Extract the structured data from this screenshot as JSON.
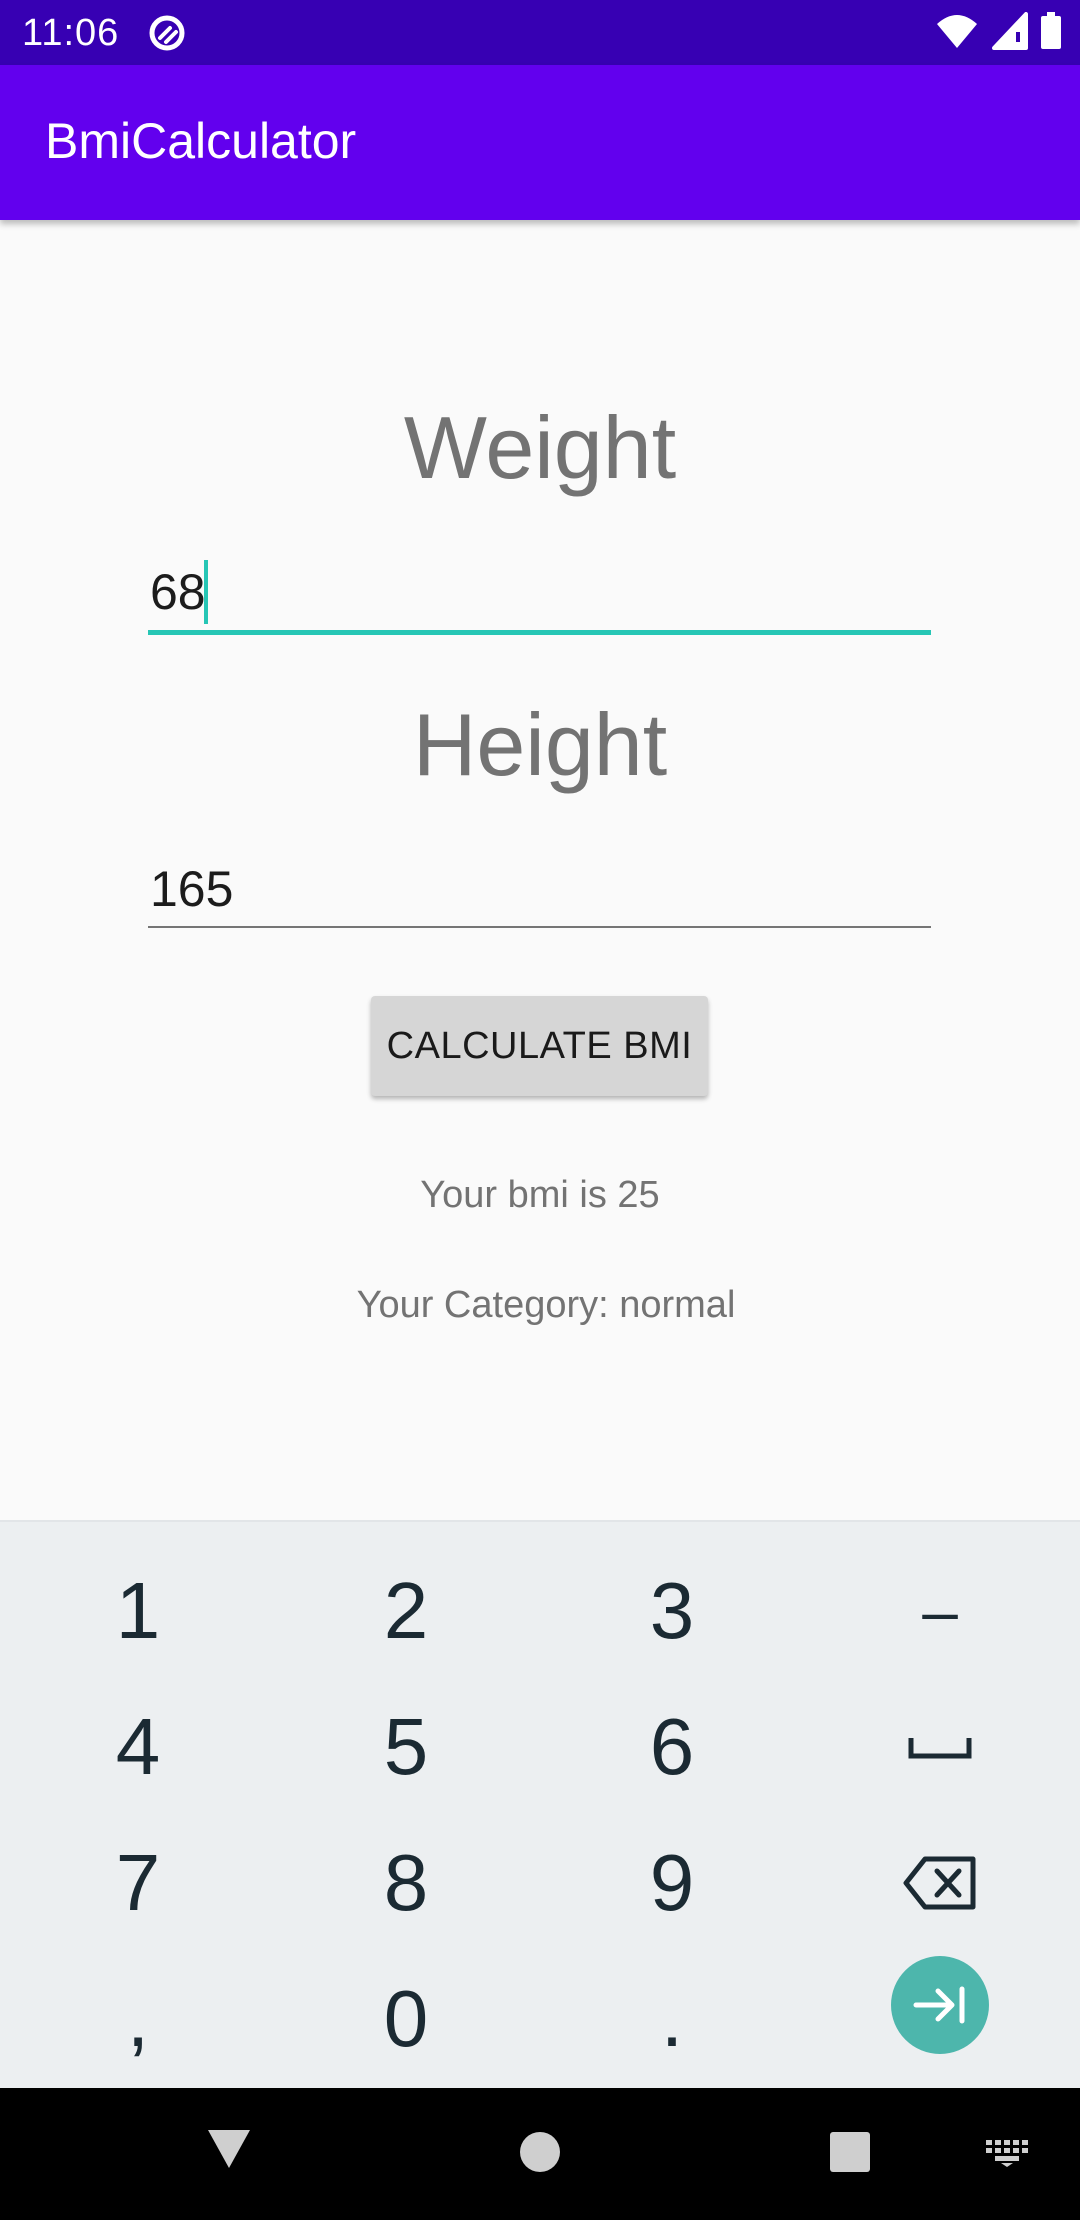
{
  "status_bar": {
    "time": "11:06",
    "icons": [
      "app-notification-icon",
      "wifi-icon",
      "cell-signal-icon",
      "battery-icon"
    ]
  },
  "app_bar": {
    "title": "BmiCalculator",
    "color": "#6200ee",
    "status_color": "#3700b3"
  },
  "form": {
    "weight_label": "Weight",
    "weight_value": "68",
    "height_label": "Height",
    "height_value": "165",
    "focus_color": "#26c6b5"
  },
  "calculate_button": {
    "label": "CALCULATE BMI"
  },
  "results": {
    "bmi_text": "Your bmi is 25",
    "category_text": "Your Category: normal"
  },
  "keyboard": {
    "rows": [
      [
        "1",
        "2",
        "3",
        "–"
      ],
      [
        "4",
        "5",
        "6",
        "space"
      ],
      [
        "7",
        "8",
        "9",
        "backspace"
      ],
      [
        ",",
        "0",
        ".",
        "next"
      ]
    ],
    "accent": "#4db6ac"
  },
  "nav_bar": {
    "icons": [
      "back-icon",
      "home-icon",
      "recents-icon",
      "keyboard-switch-icon"
    ]
  }
}
